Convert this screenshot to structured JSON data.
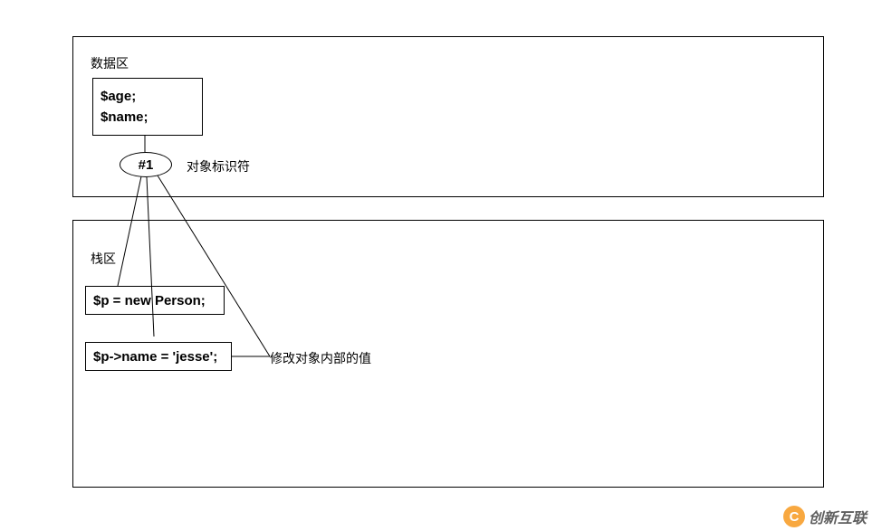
{
  "diagram": {
    "top": {
      "title": "数据区",
      "class_box": {
        "line1": "$age;",
        "line2": "$name;"
      },
      "identifier": {
        "label": "#1",
        "caption": "对象标识符"
      }
    },
    "bottom": {
      "title": "栈区",
      "code1": "$p = new Person;",
      "code2": "$p->name = 'jesse';",
      "code2_note": "修改对象内部的值"
    }
  },
  "watermark": {
    "logo_letter": "C",
    "text": "创新互联"
  }
}
